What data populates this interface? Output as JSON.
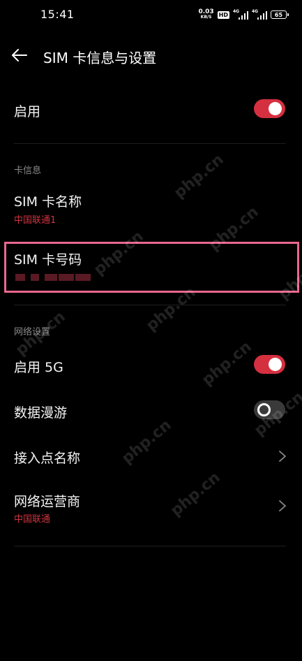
{
  "status_bar": {
    "time": "15:41",
    "net_speed_value": "0.03",
    "net_speed_unit": "KB/S",
    "hd_label": "HD",
    "signal_tag": "4G",
    "battery": "65"
  },
  "header": {
    "title": "SIM 卡信息与设置"
  },
  "enable_row": {
    "label": "启用",
    "enabled": true
  },
  "card_info": {
    "section_label": "卡信息",
    "sim_name_label": "SIM 卡名称",
    "sim_name_value": "中国联通1",
    "sim_number_label": "SIM 卡号码",
    "sim_number_value": "[redacted]"
  },
  "network": {
    "section_label": "网络设置",
    "enable_5g_label": "启用 5G",
    "enable_5g": true,
    "roaming_label": "数据漫游",
    "roaming": false,
    "apn_label": "接入点名称",
    "operator_label": "网络运营商",
    "operator_value": "中国联通"
  },
  "watermark_text": "php.cn",
  "colors": {
    "accent": "#d5303f",
    "background": "#000000",
    "highlight": "#e8688e"
  }
}
